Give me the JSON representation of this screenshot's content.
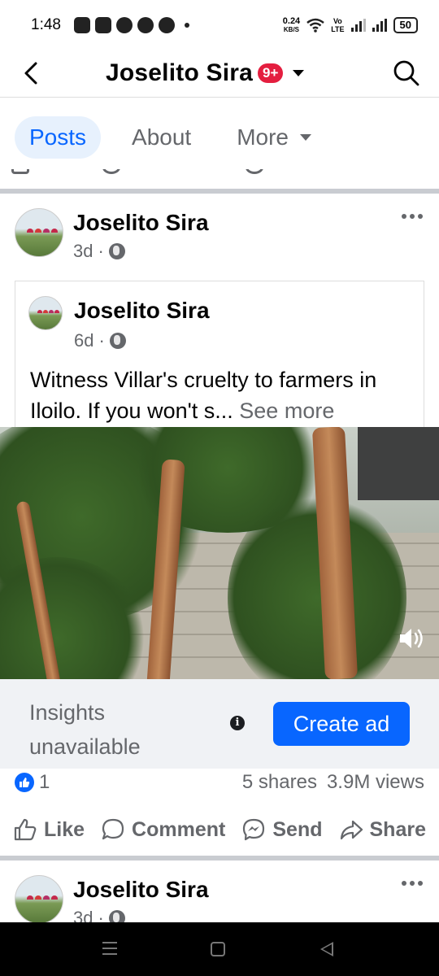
{
  "status_bar": {
    "time": "1:48",
    "net_speed_value": "0.24",
    "net_speed_unit": "KB/S",
    "vo_label": "Vo",
    "lte_label": "LTE",
    "battery": "50"
  },
  "header": {
    "title": "Joselito Sira",
    "badge": "9+"
  },
  "tabs": [
    {
      "label": "Posts",
      "active": true
    },
    {
      "label": "About",
      "active": false
    },
    {
      "label": "More",
      "active": false
    }
  ],
  "post": {
    "author": "Joselito Sira",
    "time": "3d",
    "separator": "·",
    "shared": {
      "author": "Joselito Sira",
      "time": "6d",
      "text": "Witness Villar's cruelty to farmers in Iloilo. If you won't s...",
      "see_more": "See more"
    },
    "insights": {
      "text": "Insights unavailable",
      "info_symbol": "i",
      "create_ad": "Create ad"
    },
    "stats": {
      "likes": "1",
      "shares": "5 shares",
      "views": "3.9M views"
    },
    "actions": {
      "like": "Like",
      "comment": "Comment",
      "send": "Send",
      "share": "Share"
    }
  },
  "next_post": {
    "author": "Joselito Sira",
    "time": "3d",
    "separator": "·"
  },
  "colors": {
    "accent": "#0866ff",
    "badge": "#e41e3f",
    "secondary_text": "#65676b"
  }
}
